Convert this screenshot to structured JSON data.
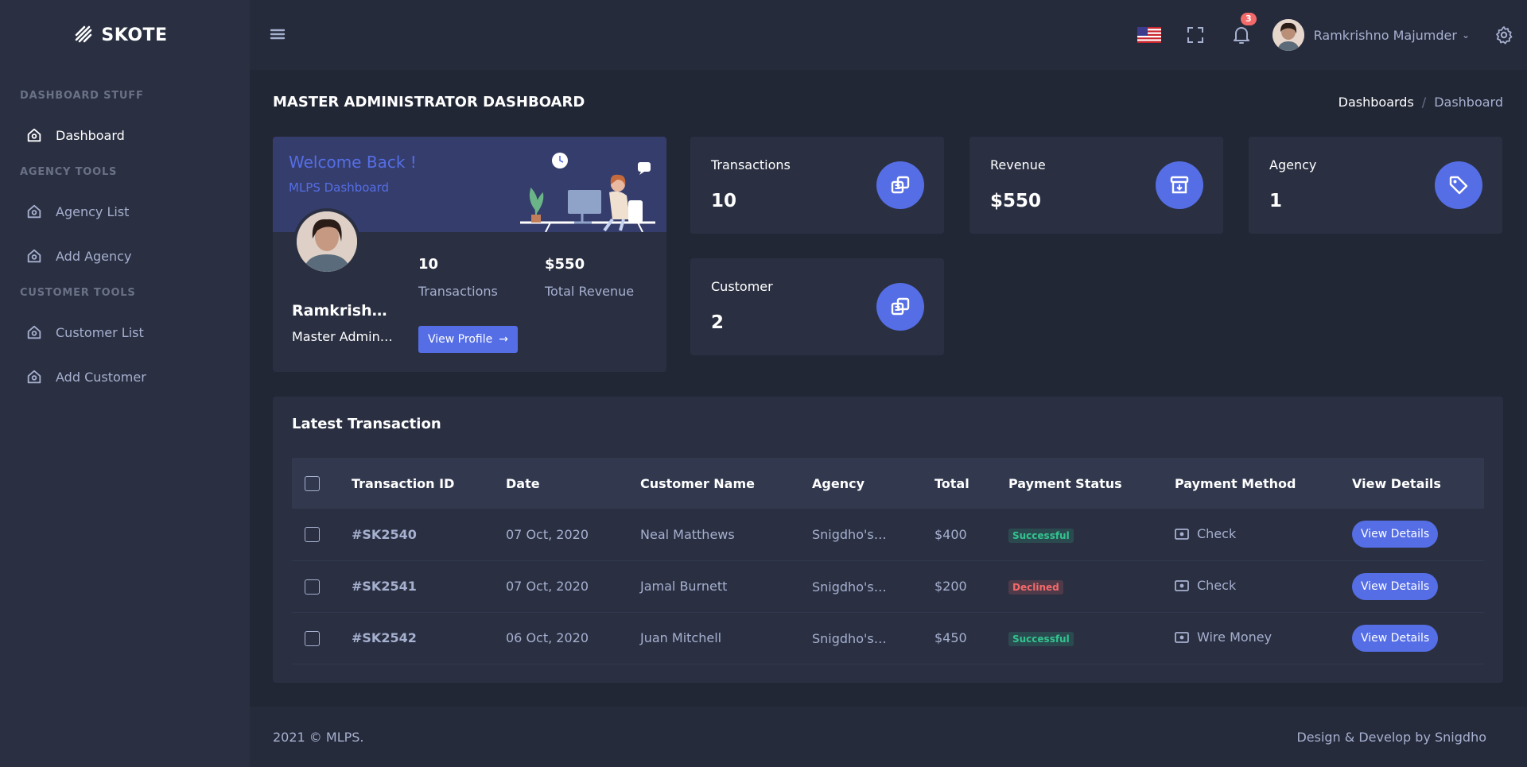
{
  "brand": {
    "name": "SKOTE"
  },
  "sidebar": {
    "sections": [
      {
        "title": "DASHBOARD STUFF",
        "items": [
          {
            "label": "Dashboard"
          }
        ]
      },
      {
        "title": "AGENCY TOOLS",
        "items": [
          {
            "label": "Agency List"
          },
          {
            "label": "Add Agency"
          }
        ]
      },
      {
        "title": "CUSTOMER TOOLS",
        "items": [
          {
            "label": "Customer List"
          },
          {
            "label": "Add Customer"
          }
        ]
      }
    ]
  },
  "topbar": {
    "notification_count": "3",
    "user_name": "Ramkrishno Majumder",
    "caret": "⌄"
  },
  "page": {
    "title": "MASTER ADMINISTRATOR DASHBOARD",
    "breadcrumb": [
      "Dashboards",
      "/",
      "Dashboard"
    ]
  },
  "welcome": {
    "title": "Welcome Back !",
    "subtitle": "MLPS Dashboard",
    "name": "Ramkrishno Majumder",
    "role": "Master Administrator",
    "stats": [
      {
        "value": "10",
        "label": "Transactions"
      },
      {
        "value": "$550",
        "label": "Total Revenue"
      }
    ],
    "button_label": "View Profile",
    "button_arrow": "→"
  },
  "stats": {
    "transactions": {
      "label": "Transactions",
      "value": "10"
    },
    "revenue": {
      "label": "Revenue",
      "value": "$550"
    },
    "agency": {
      "label": "Agency",
      "value": "1"
    },
    "customer": {
      "label": "Customer",
      "value": "2"
    }
  },
  "transactions": {
    "title": "Latest Transaction",
    "columns": [
      "Transaction ID",
      "Date",
      "Customer Name",
      "Agency",
      "Total",
      "Payment Status",
      "Payment Method",
      "View Details"
    ],
    "rows": [
      {
        "id": "#SK2540",
        "date": "07 Oct, 2020",
        "customer": "Neal Matthews",
        "agency": "Snigdho's Agency",
        "total": "$400",
        "status": "Successful",
        "status_type": "success",
        "method": "Check",
        "action": "View Details"
      },
      {
        "id": "#SK2541",
        "date": "07 Oct, 2020",
        "customer": "Jamal Burnett",
        "agency": "Snigdho's Agency",
        "total": "$200",
        "status": "Declined",
        "status_type": "failed",
        "method": "Check",
        "action": "View Details"
      },
      {
        "id": "#SK2542",
        "date": "06 Oct, 2020",
        "customer": "Juan Mitchell",
        "agency": "Snigdho's Agency",
        "total": "$450",
        "status": "Successful",
        "status_type": "success",
        "method": "Wire Money",
        "action": "View Details"
      }
    ]
  },
  "footer": {
    "left": "2021 © MLPS.",
    "right": "Design & Develop by Snigdho"
  },
  "colors": {
    "primary": "#556ee6",
    "success": "#34c38f",
    "danger": "#f46a6a",
    "sidebar_bg": "#2a3042",
    "page_bg": "#222736"
  }
}
